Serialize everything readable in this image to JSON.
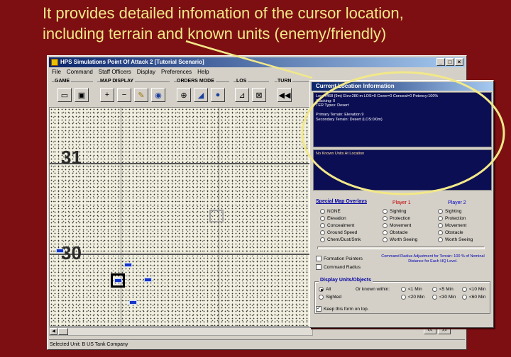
{
  "caption": {
    "line1": "It provides detailed infomation of the cursor location,",
    "line2": "including terrain and known units (enemy/friendly)"
  },
  "window": {
    "title": "HPS Simulations Point Of Attack 2 [Tutorial Scenario]",
    "buttons": {
      "minimize": "_",
      "maximize": "□",
      "close": "×"
    }
  },
  "menu": [
    "File",
    "Command",
    "Staff Officers",
    "Display",
    "Preferences",
    "Help"
  ],
  "toolbar": {
    "groups": {
      "game": "GAME",
      "map_display": "MAP DISPLAY",
      "orders_mode": "ORDERS MODE",
      "los": "LOS",
      "turn": "TURN"
    }
  },
  "map": {
    "hex_labels": [
      "31",
      "30"
    ]
  },
  "statusbar": {
    "text": "Selected Unit: B  US Tank Company"
  },
  "scroll_nav": {
    "prev": "<<",
    "next": ">>"
  },
  "panel": {
    "title": "Current Location Information",
    "info_lines": [
      "Loc: 4468 (9m)          Elev:280 m    LOS=0  Cover=0  Conceal=0  Potency:100%",
      "Stacking: 0",
      "TER Types: Desert",
      "",
      "Primary Terrain: Elevation 9",
      "Secondary Terrain: Desert (LOS:0/0m)"
    ],
    "units_text": "No Known Units At Location",
    "overlays_title": "Special Map Overlays",
    "player1": "Player 1",
    "player2": "Player 2",
    "overlay_options": [
      "NONE",
      "Elevation",
      "Concealment",
      "Ground Speed",
      "Chem/Dust/Smk"
    ],
    "p1_options": [
      "Sighting",
      "Protection",
      "Movement",
      "Obstacle",
      "Worth Seeing"
    ],
    "p2_options": [
      "Sighting",
      "Protection",
      "Movement",
      "Obstacle",
      "Worth Seeing"
    ],
    "formation_pointers": "Formation Pointers",
    "command_radius": "Command Radius",
    "cmd_radius_note": "Command Radius Adjustment for Terrain: 100 % of Nominal Distance for Each HQ Level.",
    "display_title": "Display Units/Objects",
    "display_all": "All",
    "display_sighted": "Sighted",
    "known_within": "Or known within:",
    "range_options": [
      "<1 Min",
      "<5 Min",
      "<10 Min",
      "<20 Min",
      "<30 Min",
      "<60 Min"
    ],
    "keep_on_top": "Keep this form on top."
  },
  "colors": {
    "accent": "#f2e888",
    "background": "#7d0f12",
    "info_bg": "#0c0e54",
    "unit": "#1535c8"
  }
}
